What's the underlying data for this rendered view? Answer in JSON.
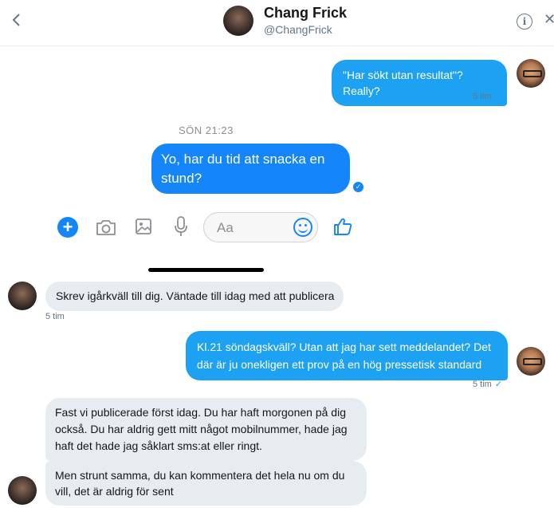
{
  "header": {
    "back_icon": "chevron-left-icon",
    "name": "Chang Frick",
    "handle": "@ChangFrick",
    "info_icon": "info-icon",
    "info_glyph": "i",
    "close_icon": "close-icon",
    "close_glyph": "✕"
  },
  "messages": [
    {
      "dir": "out",
      "text": "\"Har sökt utan resultat\"? Really?",
      "time": "5 tim",
      "status": "✓"
    },
    {
      "dir": "in",
      "text": "Skrev igårkväll till dig. Väntade till idag med att publicera",
      "time": "5 tim"
    },
    {
      "dir": "out",
      "text": "Kl.21 söndagskväll? Utan att jag har sett meddelandet? Det där är ju onekligen ett prov på en hög pressetisk standard",
      "time": "5 tim",
      "status": "✓"
    },
    {
      "dir": "in",
      "text": "Fast vi publicerade först idag. Du har haft morgonen på dig också. Du har aldrig gett mitt något mobilnummer, hade jag haft det hade jag såklart sms:at eller ringt."
    },
    {
      "dir": "in",
      "text": "Men strunt samma, du kan kommentera det hela nu om du vill, det är aldrig för sent"
    }
  ],
  "embedded_screenshot": {
    "timestamp": "SÖN 21:23",
    "message": "Yo, har du tid att snacka en stund?",
    "input_placeholder": "Aa",
    "plus_glyph": "+",
    "seen_glyph": "✓",
    "icons": [
      "plus-icon",
      "camera-icon",
      "image-icon",
      "microphone-icon",
      "emoji-icon",
      "thumbs-up-icon"
    ]
  },
  "colors": {
    "twitter_blue": "#1da1f2",
    "messenger_blue": "#1486f9",
    "incoming_bubble": "#e6ecf0",
    "meta_gray": "#657786"
  }
}
